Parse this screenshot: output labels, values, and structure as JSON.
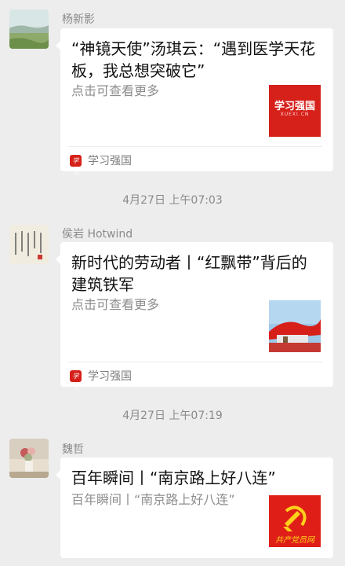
{
  "messages": [
    {
      "sender": "杨新影",
      "title": "“神镜天使”汤琪云：“遇到医学天花板，我总想突破它”",
      "desc": "点击可查看更多",
      "thumb_text": "学习强国",
      "thumb_sub": "XUEXI.CN",
      "source": "学习强国",
      "source_icon": "学习"
    },
    {
      "sender": "侯岩 Hotwind",
      "title": "新时代的劳动者丨“红飘带”背后的建筑铁军",
      "desc": "点击可查看更多",
      "source": "学习强国",
      "source_icon": "学习"
    },
    {
      "sender": "魏哲",
      "title": "百年瞬间丨“南京路上好八连”",
      "desc": "百年瞬间丨“南京路上好八连”",
      "thumb_text": "共产党员网"
    }
  ],
  "timestamps": [
    "4月27日 上午07:03",
    "4月27日 上午07:19"
  ],
  "colors": {
    "background": "#ededed",
    "card": "#ffffff",
    "brand_red": "#d6201a"
  }
}
